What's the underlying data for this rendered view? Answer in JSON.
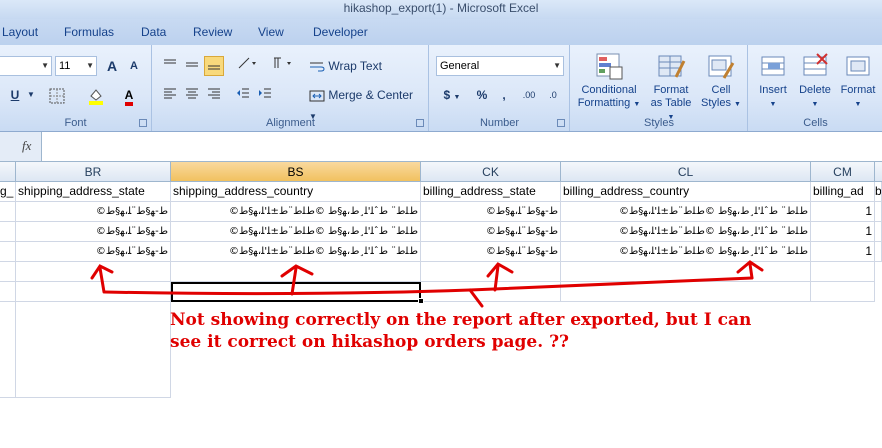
{
  "window": {
    "title": "hikashop_export(1) - Microsoft Excel"
  },
  "tabs": [
    {
      "label": "Layout"
    },
    {
      "label": "Formulas"
    },
    {
      "label": "Data"
    },
    {
      "label": "Review"
    },
    {
      "label": "View"
    },
    {
      "label": "Developer"
    }
  ],
  "ribbon": {
    "font": {
      "size": "11",
      "group": "Font",
      "grow_label": "A",
      "shrink_label": "A",
      "underline_label": "U",
      "color_label": "A"
    },
    "alignment": {
      "group": "Alignment",
      "wrap_text": "Wrap Text",
      "merge_center": "Merge & Center"
    },
    "number": {
      "group": "Number",
      "format": "General",
      "currency": "$",
      "percent": "%",
      "comma": ",",
      "inc_dec": ".00",
      "dec_dec": ".0"
    },
    "styles": {
      "group": "Styles",
      "conditional_line1": "Conditional",
      "conditional_line2": "Formatting",
      "table_line1": "Format",
      "table_line2": "as Table",
      "cell_line1": "Cell",
      "cell_line2": "Styles"
    },
    "cells": {
      "group": "Cells",
      "insert": "Insert",
      "delete": "Delete",
      "format": "Format"
    }
  },
  "formula_bar": {
    "fx": "fx",
    "value": ""
  },
  "columns": [
    {
      "label": "BR",
      "header": "shipping_address_state"
    },
    {
      "label": "BS",
      "header": "shipping_address_country"
    },
    {
      "label": "CK",
      "header": "billing_address_state"
    },
    {
      "label": "CL",
      "header": "billing_address_country"
    },
    {
      "label": "CM",
      "header": "billing_ad"
    }
  ],
  "left_partial_header": "g_",
  "right_partial_header": "b",
  "rows": [
    {
      "state": "©ﻁ‐ﻬ§ﻁ¨ﻠ،ﻬ§ﻁ",
      "country": "©ﻁ‌ﻠ‌ﻁ¨ ﻁˆﻠ'ﻠ¸ﻁ،ﻬ§ﻁ ©ﻁ‌ﻠ‌ﻁ¨ﻁ±ﻠ'ﻠ،ﻬ§ﻁ",
      "billing_state": "©ﻁ‐ﻬ§ﻁ¨ﻠ،ﻬ§ﻁ",
      "billing_country": "©ﻁ‌ﻠ‌ﻁ¨ ﻁˆﻠ'ﻠ¸ﻁ،ﻬ§ﻁ ©ﻁ‌ﻠ‌ﻁ¨ﻁ±ﻠ'ﻠ،ﻬ§ﻁ",
      "billing_ad": "1"
    },
    {
      "state": "©ﻁ‐ﻬ§ﻁ¨ﻠ،ﻬ§ﻁ",
      "country": "©ﻁ‌ﻠ‌ﻁ¨ ﻁˆﻠ'ﻠ¸ﻁ،ﻬ§ﻁ ©ﻁ‌ﻠ‌ﻁ¨ﻁ±ﻠ'ﻠ،ﻬ§ﻁ",
      "billing_state": "©ﻁ‐ﻬ§ﻁ¨ﻠ،ﻬ§ﻁ",
      "billing_country": "©ﻁ‌ﻠ‌ﻁ¨ ﻁˆﻠ'ﻠ¸ﻁ،ﻬ§ﻁ ©ﻁ‌ﻠ‌ﻁ¨ﻁ±ﻠ'ﻠ،ﻬ§ﻁ",
      "billing_ad": "1"
    },
    {
      "state": "©ﻁ‐ﻬ§ﻁ¨ﻠ،ﻬ§ﻁ",
      "country": "©ﻁ‌ﻠ‌ﻁ¨ ﻁˆﻠ'ﻠ¸ﻁ،ﻬ§ﻁ ©ﻁ‌ﻠ‌ﻁ¨ﻁ±ﻠ'ﻠ،ﻬ§ﻁ",
      "billing_state": "©ﻁ‐ﻬ§ﻁ¨ﻠ،ﻬ§ﻁ",
      "billing_country": "©ﻁ‌ﻠ‌ﻁ¨ ﻁˆﻠ'ﻠ¸ﻁ،ﻬ§ﻁ ©ﻁ‌ﻠ‌ﻁ¨ﻁ±ﻠ'ﻠ،ﻬ§ﻁ",
      "billing_ad": "1"
    }
  ],
  "annotation": {
    "line1": "Not showing correctly on the report after exported, but I can",
    "line2": "see it correct on  hikashop orders page. ??"
  },
  "colors": {
    "annotation": "#e00000",
    "selected_header": "#f1c15f",
    "ribbon": "#dbe7f8"
  }
}
